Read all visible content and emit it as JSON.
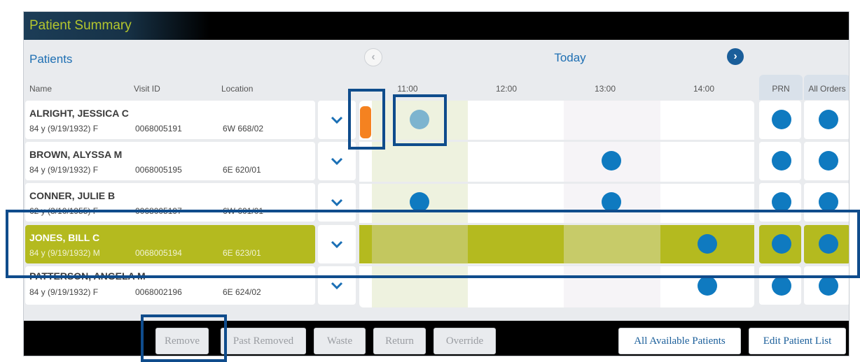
{
  "app": {
    "title": "Patient Summary"
  },
  "sidebar": {
    "heading": "Patients",
    "columns": {
      "name": "Name",
      "visit_id": "Visit ID",
      "location": "Location"
    }
  },
  "timeline": {
    "day_label": "Today",
    "times": [
      "11:00",
      "12:00",
      "13:00",
      "14:00"
    ],
    "extra_columns": [
      "PRN",
      "All Orders"
    ]
  },
  "patients": [
    {
      "name": "ALRIGHT, JESSICA C",
      "details": "84 y (9/19/1932) F",
      "visit_id": "0068005191",
      "location": "6W 668/02"
    },
    {
      "name": "BROWN, ALYSSA M",
      "details": "84 y (9/19/1932) F",
      "visit_id": "0068005195",
      "location": "6E 620/01"
    },
    {
      "name": "CONNER, JULIE B",
      "details": "62 y (3/10/1955) F",
      "visit_id": "0068005197",
      "location": "6W 601/01"
    },
    {
      "name": "JONES, BILL C",
      "details": "84 y (9/19/1932) M",
      "visit_id": "0068005194",
      "location": "6E 623/01"
    },
    {
      "name": "PATTERSON, ANGELA M",
      "details": "84 y (9/19/1932) F",
      "visit_id": "0068002196",
      "location": "6E 624/02"
    }
  ],
  "footer": {
    "remove": "Remove",
    "past_removed": "Past Removed",
    "waste": "Waste",
    "return": "Return",
    "override": "Override",
    "all_available_patients": "All Available Patients",
    "edit_patient_list": "Edit Patient List"
  },
  "colors": {
    "accent_green": "#b4ba1f",
    "dose_blue": "#0f7ac0",
    "alert_orange": "#f58220",
    "highlight_border": "#0f4c8c"
  }
}
